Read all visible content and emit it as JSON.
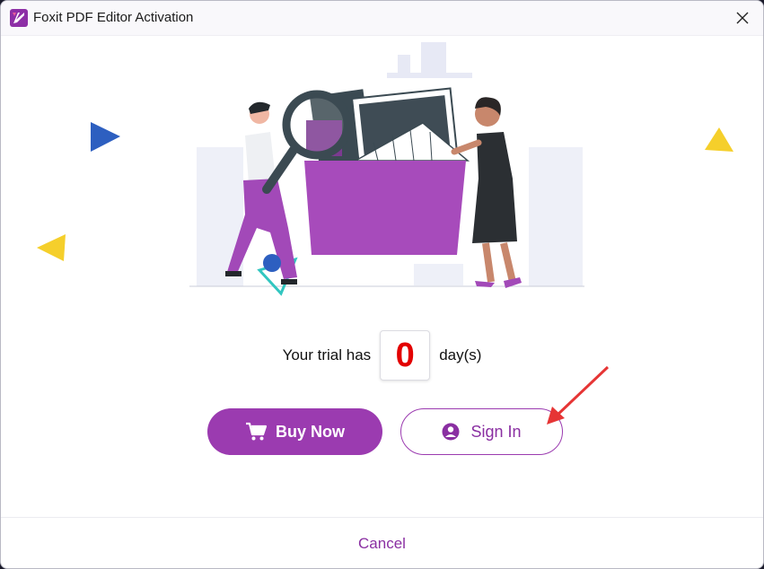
{
  "window": {
    "title": "Foxit PDF Editor Activation"
  },
  "trial": {
    "prefix": "Your trial has",
    "days": "0",
    "suffix": "day(s)"
  },
  "buttons": {
    "buy_now": "Buy Now",
    "sign_in": "Sign In",
    "cancel": "Cancel"
  },
  "icons": {
    "app": "foxit-logo-icon",
    "close": "close-icon",
    "cart": "shopping-cart-icon",
    "user": "user-circle-icon"
  },
  "colors": {
    "accent": "#9b3bb0",
    "trial_count": "#e30000"
  }
}
